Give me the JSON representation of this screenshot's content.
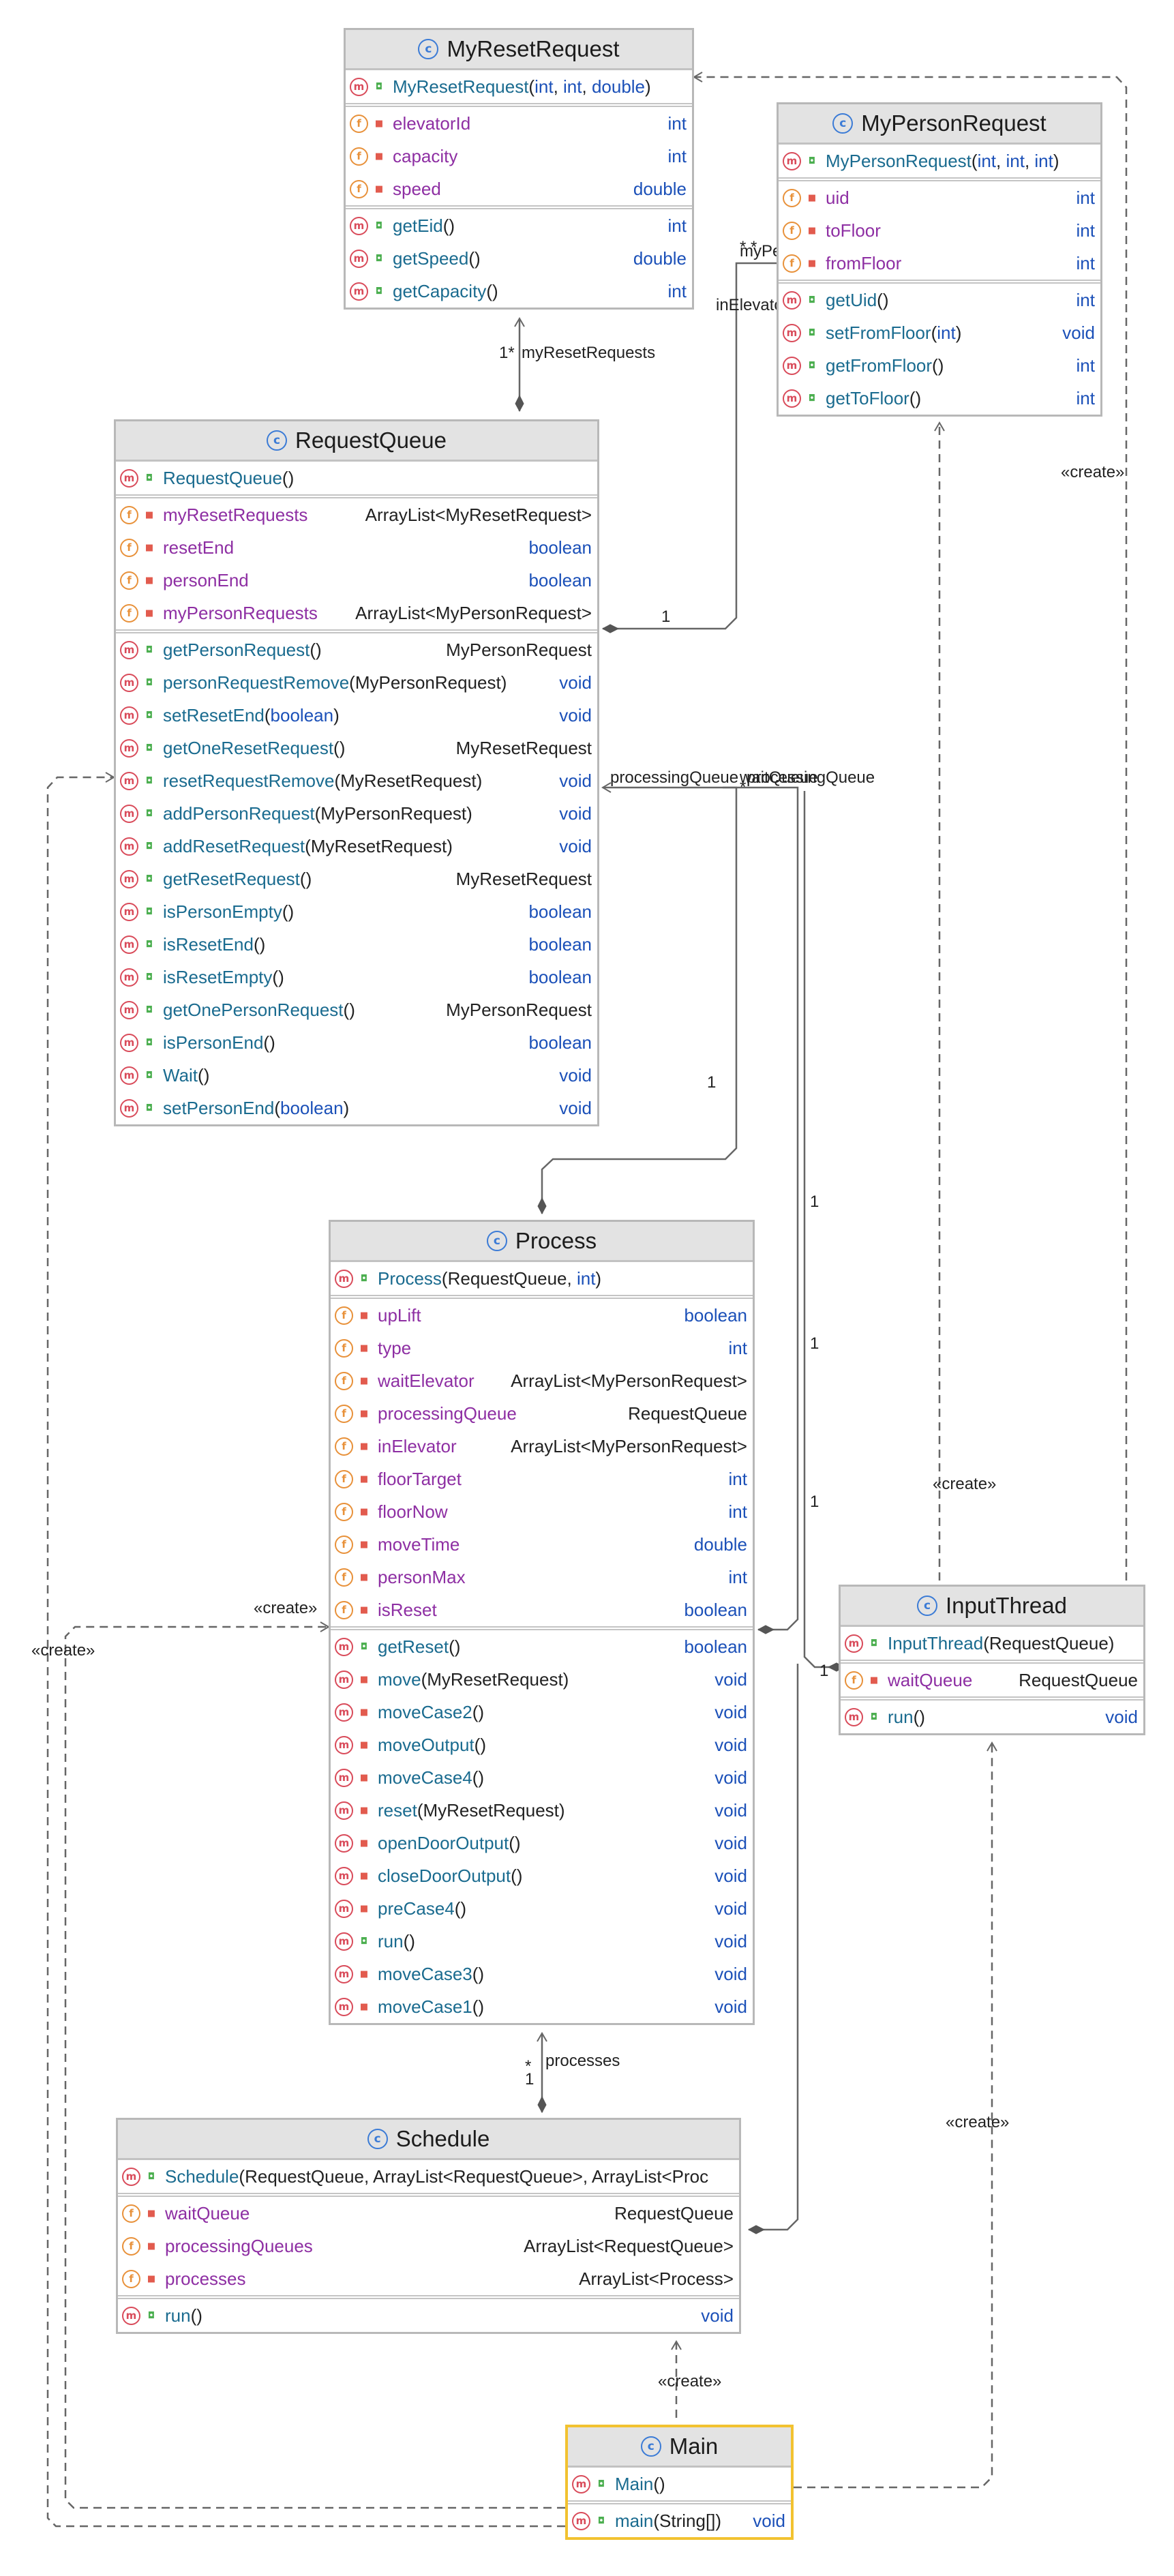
{
  "colors": {
    "field_icon": "#e8913a",
    "method_icon": "#d94b5a",
    "class_icon": "#3b7bd6",
    "name_method": "#1a6b8f",
    "name_field": "#8e2fa3",
    "primitive_type": "#1b50b8",
    "selected_border": "#f2c230"
  },
  "icons": {
    "class": "c-circle-icon",
    "field": "f-circle-icon",
    "method": "m-circle-icon",
    "public": "unlock-icon",
    "private": "lock-icon"
  },
  "classes": {
    "myResetRequest": {
      "name": "MyResetRequest",
      "members": [
        {
          "kind": "m",
          "vis": "pub",
          "name": "MyResetRequest",
          "args": [
            "int",
            "int",
            "double"
          ],
          "type": ""
        },
        {
          "kind": "f",
          "vis": "pri",
          "name": "elevatorId",
          "args": null,
          "type": "int"
        },
        {
          "kind": "f",
          "vis": "pri",
          "name": "capacity",
          "args": null,
          "type": "int"
        },
        {
          "kind": "f",
          "vis": "pri",
          "name": "speed",
          "args": null,
          "type": "double"
        },
        {
          "kind": "m",
          "vis": "pub",
          "name": "getEid",
          "args": [],
          "type": "int"
        },
        {
          "kind": "m",
          "vis": "pub",
          "name": "getSpeed",
          "args": [],
          "type": "double"
        },
        {
          "kind": "m",
          "vis": "pub",
          "name": "getCapacity",
          "args": [],
          "type": "int"
        }
      ]
    },
    "myPersonRequest": {
      "name": "MyPersonRequest",
      "members": [
        {
          "kind": "m",
          "vis": "pub",
          "name": "MyPersonRequest",
          "args": [
            "int",
            "int",
            "int"
          ],
          "type": ""
        },
        {
          "kind": "f",
          "vis": "pri",
          "name": "uid",
          "args": null,
          "type": "int"
        },
        {
          "kind": "f",
          "vis": "pri",
          "name": "toFloor",
          "args": null,
          "type": "int"
        },
        {
          "kind": "f",
          "vis": "pri",
          "name": "fromFloor",
          "args": null,
          "type": "int"
        },
        {
          "kind": "m",
          "vis": "pub",
          "name": "getUid",
          "args": [],
          "type": "int"
        },
        {
          "kind": "m",
          "vis": "pub",
          "name": "setFromFloor",
          "args": [
            "int"
          ],
          "type": "void"
        },
        {
          "kind": "m",
          "vis": "pub",
          "name": "getFromFloor",
          "args": [],
          "type": "int"
        },
        {
          "kind": "m",
          "vis": "pub",
          "name": "getToFloor",
          "args": [],
          "type": "int"
        }
      ]
    },
    "requestQueue": {
      "name": "RequestQueue",
      "members": [
        {
          "kind": "m",
          "vis": "pub",
          "name": "RequestQueue",
          "args": [],
          "type": ""
        },
        {
          "kind": "f",
          "vis": "pri",
          "name": "myResetRequests",
          "args": null,
          "type": "ArrayList<MyResetRequest>"
        },
        {
          "kind": "f",
          "vis": "pri",
          "name": "resetEnd",
          "args": null,
          "type": "boolean"
        },
        {
          "kind": "f",
          "vis": "pri",
          "name": "personEnd",
          "args": null,
          "type": "boolean"
        },
        {
          "kind": "f",
          "vis": "pri",
          "name": "myPersonRequests",
          "args": null,
          "type": "ArrayList<MyPersonRequest>"
        },
        {
          "kind": "m",
          "vis": "pub",
          "name": "getPersonRequest",
          "args": [],
          "type": "MyPersonRequest"
        },
        {
          "kind": "m",
          "vis": "pub",
          "name": "personRequestRemove",
          "args": [
            "MyPersonRequest"
          ],
          "type": "void"
        },
        {
          "kind": "m",
          "vis": "pub",
          "name": "setResetEnd",
          "args": [
            "boolean"
          ],
          "type": "void"
        },
        {
          "kind": "m",
          "vis": "pub",
          "name": "getOneResetRequest",
          "args": [],
          "type": "MyResetRequest"
        },
        {
          "kind": "m",
          "vis": "pub",
          "name": "resetRequestRemove",
          "args": [
            "MyResetRequest"
          ],
          "type": "void"
        },
        {
          "kind": "m",
          "vis": "pub",
          "name": "addPersonRequest",
          "args": [
            "MyPersonRequest"
          ],
          "type": "void"
        },
        {
          "kind": "m",
          "vis": "pub",
          "name": "addResetRequest",
          "args": [
            "MyResetRequest"
          ],
          "type": "void"
        },
        {
          "kind": "m",
          "vis": "pub",
          "name": "getResetRequest",
          "args": [],
          "type": "MyResetRequest"
        },
        {
          "kind": "m",
          "vis": "pub",
          "name": "isPersonEmpty",
          "args": [],
          "type": "boolean"
        },
        {
          "kind": "m",
          "vis": "pub",
          "name": "isResetEnd",
          "args": [],
          "type": "boolean"
        },
        {
          "kind": "m",
          "vis": "pub",
          "name": "isResetEmpty",
          "args": [],
          "type": "boolean"
        },
        {
          "kind": "m",
          "vis": "pub",
          "name": "getOnePersonRequest",
          "args": [],
          "type": "MyPersonRequest"
        },
        {
          "kind": "m",
          "vis": "pub",
          "name": "isPersonEnd",
          "args": [],
          "type": "boolean"
        },
        {
          "kind": "m",
          "vis": "pub",
          "name": "Wait",
          "args": [],
          "type": "void"
        },
        {
          "kind": "m",
          "vis": "pub",
          "name": "setPersonEnd",
          "args": [
            "boolean"
          ],
          "type": "void"
        }
      ]
    },
    "process": {
      "name": "Process",
      "members": [
        {
          "kind": "m",
          "vis": "pub",
          "name": "Process",
          "args": [
            "RequestQueue",
            "int"
          ],
          "type": ""
        },
        {
          "kind": "f",
          "vis": "pri",
          "name": "upLift",
          "args": null,
          "type": "boolean"
        },
        {
          "kind": "f",
          "vis": "pri",
          "name": "type",
          "args": null,
          "type": "int"
        },
        {
          "kind": "f",
          "vis": "pri",
          "name": "waitElevator",
          "args": null,
          "type": "ArrayList<MyPersonRequest>"
        },
        {
          "kind": "f",
          "vis": "pri",
          "name": "processingQueue",
          "args": null,
          "type": "RequestQueue"
        },
        {
          "kind": "f",
          "vis": "pri",
          "name": "inElevator",
          "args": null,
          "type": "ArrayList<MyPersonRequest>"
        },
        {
          "kind": "f",
          "vis": "pri",
          "name": "floorTarget",
          "args": null,
          "type": "int"
        },
        {
          "kind": "f",
          "vis": "pri",
          "name": "floorNow",
          "args": null,
          "type": "int"
        },
        {
          "kind": "f",
          "vis": "pri",
          "name": "moveTime",
          "args": null,
          "type": "double"
        },
        {
          "kind": "f",
          "vis": "pri",
          "name": "personMax",
          "args": null,
          "type": "int"
        },
        {
          "kind": "f",
          "vis": "pri",
          "name": "isReset",
          "args": null,
          "type": "boolean"
        },
        {
          "kind": "m",
          "vis": "pub",
          "name": "getReset",
          "args": [],
          "type": "boolean"
        },
        {
          "kind": "m",
          "vis": "pri",
          "name": "move",
          "args": [
            "MyResetRequest"
          ],
          "type": "void"
        },
        {
          "kind": "m",
          "vis": "pri",
          "name": "moveCase2",
          "args": [],
          "type": "void"
        },
        {
          "kind": "m",
          "vis": "pri",
          "name": "moveOutput",
          "args": [],
          "type": "void"
        },
        {
          "kind": "m",
          "vis": "pri",
          "name": "moveCase4",
          "args": [],
          "type": "void"
        },
        {
          "kind": "m",
          "vis": "pri",
          "name": "reset",
          "args": [
            "MyResetRequest"
          ],
          "type": "void"
        },
        {
          "kind": "m",
          "vis": "pri",
          "name": "openDoorOutput",
          "args": [],
          "type": "void"
        },
        {
          "kind": "m",
          "vis": "pri",
          "name": "closeDoorOutput",
          "args": [],
          "type": "void"
        },
        {
          "kind": "m",
          "vis": "pri",
          "name": "preCase4",
          "args": [],
          "type": "void"
        },
        {
          "kind": "m",
          "vis": "pub",
          "name": "run",
          "args": [],
          "type": "void"
        },
        {
          "kind": "m",
          "vis": "pri",
          "name": "moveCase3",
          "args": [],
          "type": "void"
        },
        {
          "kind": "m",
          "vis": "pri",
          "name": "moveCase1",
          "args": [],
          "type": "void"
        }
      ]
    },
    "inputThread": {
      "name": "InputThread",
      "members": [
        {
          "kind": "m",
          "vis": "pub",
          "name": "InputThread",
          "args": [
            "RequestQueue"
          ],
          "type": ""
        },
        {
          "kind": "f",
          "vis": "pri",
          "name": "waitQueue",
          "args": null,
          "type": "RequestQueue"
        },
        {
          "kind": "m",
          "vis": "pub",
          "name": "run",
          "args": [],
          "type": "void"
        }
      ]
    },
    "schedule": {
      "name": "Schedule",
      "members": [
        {
          "kind": "m",
          "vis": "pub",
          "name": "Schedule",
          "args": [
            "RequestQueue",
            "ArrayList<RequestQueue>",
            "ArrayList<Proc"
          ],
          "type": ""
        },
        {
          "kind": "f",
          "vis": "pri",
          "name": "waitQueue",
          "args": null,
          "type": "RequestQueue"
        },
        {
          "kind": "f",
          "vis": "pri",
          "name": "processingQueues",
          "args": null,
          "type": "ArrayList<RequestQueue>"
        },
        {
          "kind": "f",
          "vis": "pri",
          "name": "processes",
          "args": null,
          "type": "ArrayList<Process>"
        },
        {
          "kind": "m",
          "vis": "pub",
          "name": "run",
          "args": [],
          "type": "void"
        }
      ]
    },
    "main": {
      "name": "Main",
      "members": [
        {
          "kind": "m",
          "vis": "pub",
          "name": "Main",
          "args": [],
          "type": ""
        },
        {
          "kind": "m",
          "vis": "pub",
          "name": "main",
          "args": [
            "String[]"
          ],
          "type": "void"
        }
      ]
    }
  },
  "edge_labels": {
    "create": "«create»",
    "my_reset_requests": "myResetRequests",
    "my_person_requests": "myPersonRequests",
    "in_elevator": "inElevator",
    "processing_queue": "processingQueue",
    "wait_queue": "waitQueue",
    "processes": "processes",
    "one": "1",
    "many": "*",
    "one_many": "1*",
    "many_many": "* *"
  }
}
